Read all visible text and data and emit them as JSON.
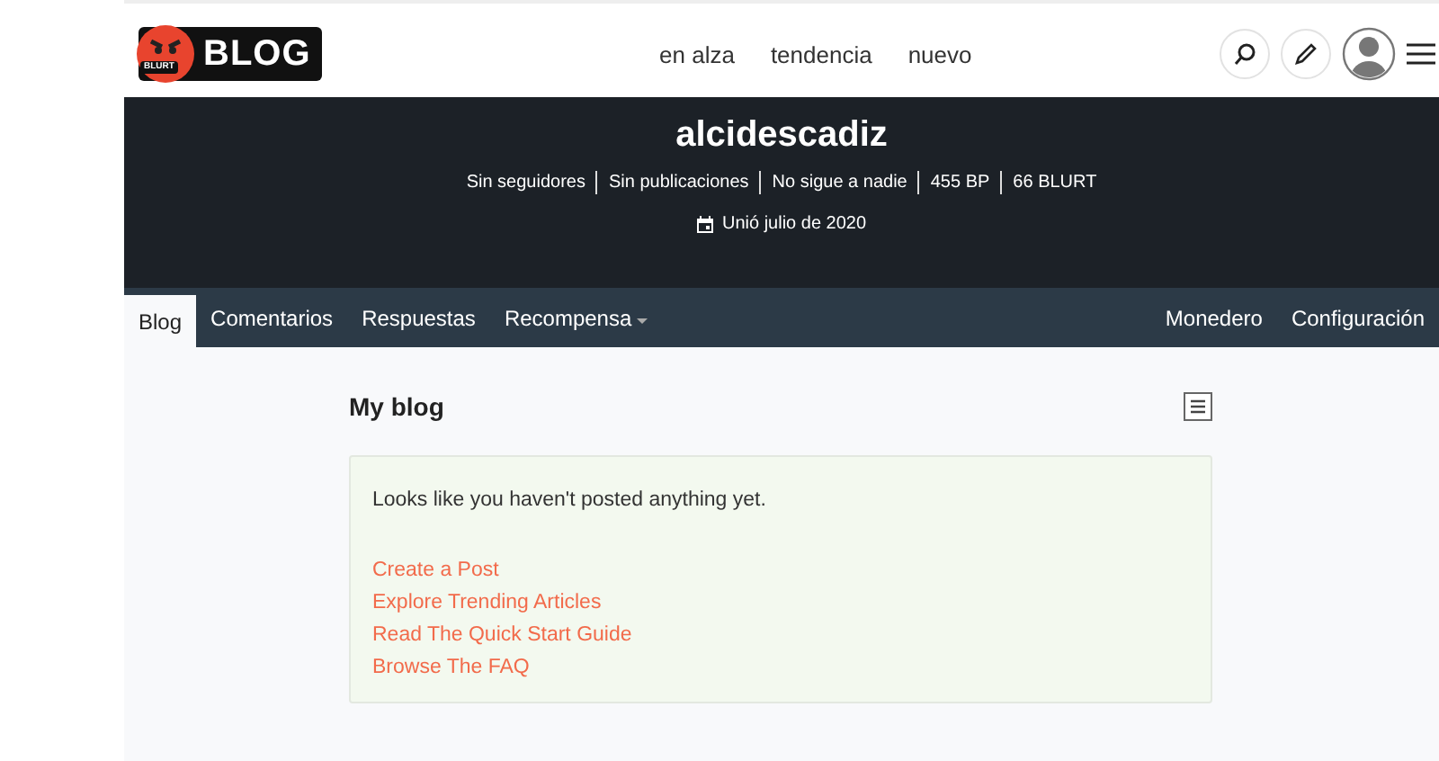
{
  "header": {
    "logo_badge": "BLURT",
    "logo_text": "BLOG",
    "nav": [
      {
        "label": "en alza"
      },
      {
        "label": "tendencia"
      },
      {
        "label": "nuevo"
      }
    ]
  },
  "profile": {
    "name": "alcidescadiz",
    "stats": [
      "Sin seguidores",
      "Sin publicaciones",
      "No sigue a nadie",
      "455 BP",
      "66 BLURT"
    ],
    "joined": "Unió julio de 2020"
  },
  "tabs": [
    {
      "label": "Blog",
      "selected": true,
      "dropdown": false
    },
    {
      "label": "Comentarios",
      "selected": false,
      "dropdown": false
    },
    {
      "label": "Respuestas",
      "selected": false,
      "dropdown": false
    },
    {
      "label": "Recompensa",
      "selected": false,
      "dropdown": true
    }
  ],
  "right_tabs": [
    {
      "label": "Monedero",
      "selected": false
    },
    {
      "label": "Configuración",
      "selected": false
    }
  ],
  "blog": {
    "title": "My blog",
    "message": "Looks like you haven't posted anything yet.",
    "links": [
      "Create a Post",
      "Explore Trending Articles",
      "Read The Quick Start Guide",
      "Browse The FAQ"
    ]
  }
}
